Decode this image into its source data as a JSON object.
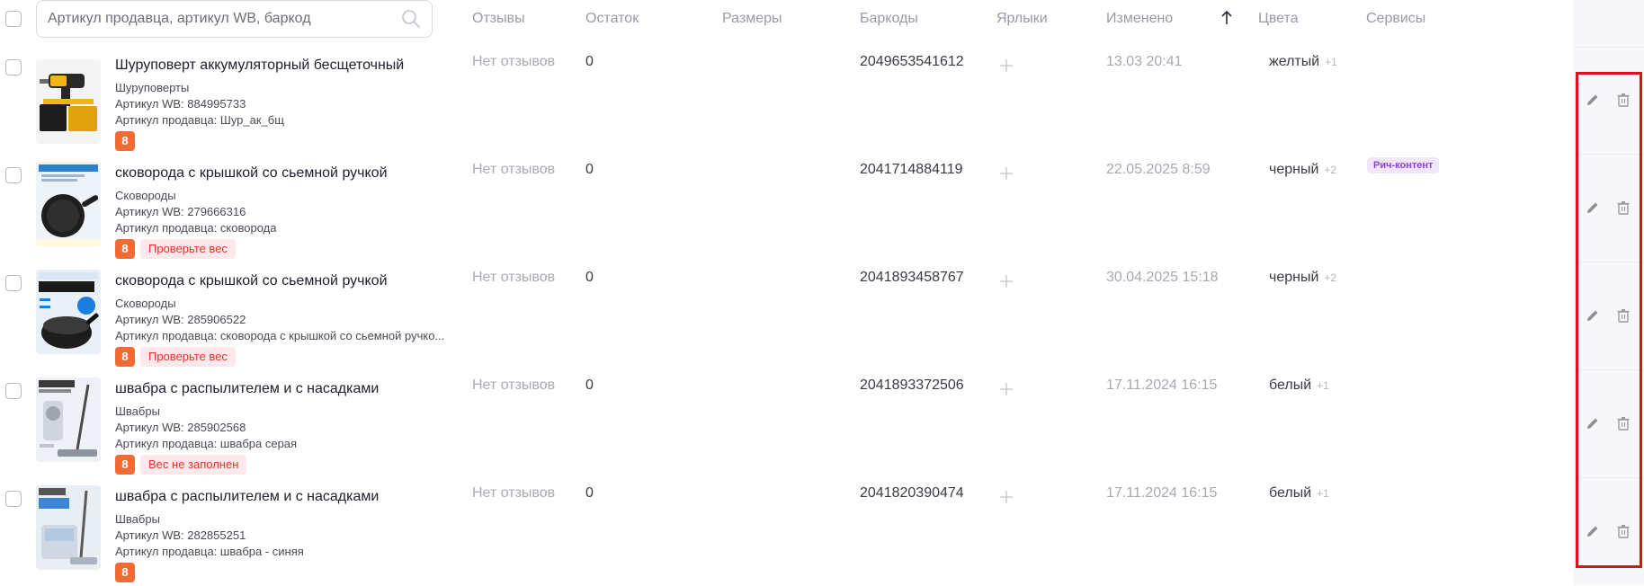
{
  "search": {
    "placeholder": "Артикул продавца, артикул WB, баркод",
    "icon": "search-icon"
  },
  "columns": {
    "reviews": "Отзывы",
    "stock": "Остаток",
    "sizes": "Размеры",
    "barcodes": "Баркоды",
    "labels": "Ярлыки",
    "changed": "Изменено",
    "colors": "Цвета",
    "services": "Сервисы"
  },
  "sort": {
    "icon": "arrow-up-icon",
    "column": "Изменено",
    "direction": "asc"
  },
  "colors_theme": {
    "accent_orange": "#f46a35",
    "warning_red": "#e5322d",
    "highlight_border": "#e0101a",
    "service_purple": "#8e3fd8"
  },
  "rows": [
    {
      "title": "Шуруповерт аккумуляторный бесщеточный",
      "category": "Шуруповерты",
      "wb_article": "Артикул WB: 884995733",
      "seller_article": "Артикул продавца: Шур_ак_бщ",
      "badge": "8",
      "warning": "",
      "reviews": "Нет отзывов",
      "stock": "0",
      "barcode": "2049653541612",
      "changed": "13.03 20:41",
      "color": "желтый",
      "color_extra": "+1",
      "service": ""
    },
    {
      "title": "сковорода с крышкой со сьемной ручкой",
      "category": "Сковороды",
      "wb_article": "Артикул WB: 279666316",
      "seller_article": "Артикул продавца: сковорода",
      "badge": "8",
      "warning": "Проверьте вес",
      "reviews": "Нет отзывов",
      "stock": "0",
      "barcode": "2041714884119",
      "changed": "22.05.2025 8:59",
      "color": "черный",
      "color_extra": "+2",
      "service": "Рич-контент"
    },
    {
      "title": "сковорода с крышкой со сьемной ручкой",
      "category": "Сковороды",
      "wb_article": "Артикул WB: 285906522",
      "seller_article": "Артикул продавца: сковорода с крышкой со сьемной ручко...",
      "badge": "8",
      "warning": "Проверьте вес",
      "reviews": "Нет отзывов",
      "stock": "0",
      "barcode": "2041893458767",
      "changed": "30.04.2025 15:18",
      "color": "черный",
      "color_extra": "+2",
      "service": ""
    },
    {
      "title": "швабра с распылителем и с насадками",
      "category": "Швабры",
      "wb_article": "Артикул WB: 285902568",
      "seller_article": "Артикул продавца: швабра серая",
      "badge": "8",
      "warning": "Вес не заполнен",
      "reviews": "Нет отзывов",
      "stock": "0",
      "barcode": "2041893372506",
      "changed": "17.11.2024 16:15",
      "color": "белый",
      "color_extra": "+1",
      "service": ""
    },
    {
      "title": "швабра с распылителем и с насадками",
      "category": "Швабры",
      "wb_article": "Артикул WB: 282855251",
      "seller_article": "Артикул продавца: швабра - синяя",
      "badge": "8",
      "warning": "",
      "reviews": "Нет отзывов",
      "stock": "0",
      "barcode": "2041820390474",
      "changed": "17.11.2024 16:15",
      "color": "белый",
      "color_extra": "+1",
      "service": ""
    }
  ]
}
